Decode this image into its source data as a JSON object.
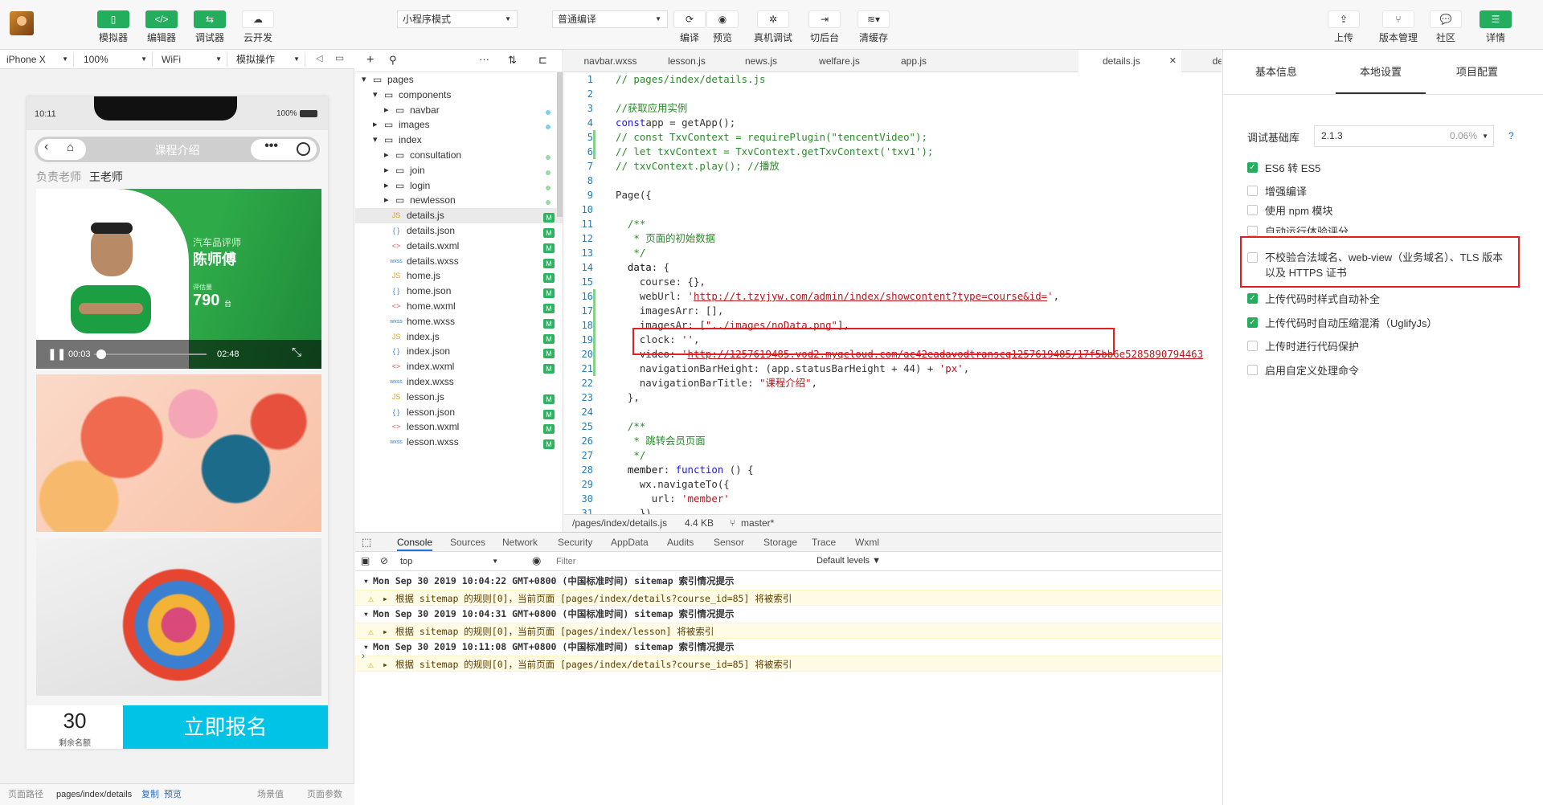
{
  "toolbar": {
    "simulator": "模拟器",
    "editor": "编辑器",
    "debugger": "调试器",
    "cloud": "云开发",
    "mode_select": "小程序模式",
    "compile_select": "普通编译",
    "compile": "编译",
    "preview": "预览",
    "real_debug": "真机调试",
    "switch_bg": "切后台",
    "clear_cache": "清缓存",
    "upload": "上传",
    "version": "版本管理",
    "community": "社区",
    "details": "详情"
  },
  "device_bar": {
    "device": "iPhone X",
    "zoom": "100%",
    "network": "WiFi",
    "simulate": "模拟操作"
  },
  "phone": {
    "time": "10:11",
    "battery": "100%",
    "nav_title": "课程介绍",
    "teacher_label": "负责老师",
    "teacher_name": "王老师",
    "video_role": "汽车品评师",
    "video_name": "陈师傅",
    "video_score_label": "评估量",
    "video_score": "790",
    "video_score_unit": "台",
    "video_current": "00:03",
    "video_total": "02:48",
    "video_progress": 0.02,
    "remaining_count": "30",
    "remaining_label": "剩余名额",
    "signup_button": "立即报名"
  },
  "page_path": {
    "label": "页面路径",
    "path": "pages/index/details",
    "copy": "复制",
    "preview": "预览",
    "scene": "场景值",
    "params": "页面参数"
  },
  "file_tree": [
    {
      "name": "pages",
      "type": "folder",
      "depth": 0,
      "open": true
    },
    {
      "name": "components",
      "type": "folder",
      "depth": 1,
      "open": true
    },
    {
      "name": "navbar",
      "type": "folder",
      "depth": 2,
      "open": false,
      "dot": "blue"
    },
    {
      "name": "images",
      "type": "folder",
      "depth": 1,
      "open": false,
      "dot": "blue"
    },
    {
      "name": "index",
      "type": "folder",
      "depth": 1,
      "open": true
    },
    {
      "name": "consultation",
      "type": "folder",
      "depth": 2,
      "open": false,
      "dot": "green"
    },
    {
      "name": "join",
      "type": "folder",
      "depth": 2,
      "open": false,
      "dot": "green"
    },
    {
      "name": "login",
      "type": "folder",
      "depth": 2,
      "open": false,
      "dot": "green"
    },
    {
      "name": "newlesson",
      "type": "folder",
      "depth": 2,
      "open": false,
      "dot": "green"
    },
    {
      "name": "details.js",
      "type": "JS",
      "depth": 2,
      "badge": "M",
      "selected": true
    },
    {
      "name": "details.json",
      "type": "{ }",
      "depth": 2,
      "badge": "M"
    },
    {
      "name": "details.wxml",
      "type": "<>",
      "depth": 2,
      "badge": "M"
    },
    {
      "name": "details.wxss",
      "type": "wxss",
      "depth": 2,
      "badge": "M"
    },
    {
      "name": "home.js",
      "type": "JS",
      "depth": 2,
      "badge": "M"
    },
    {
      "name": "home.json",
      "type": "{ }",
      "depth": 2,
      "badge": "M"
    },
    {
      "name": "home.wxml",
      "type": "<>",
      "depth": 2,
      "badge": "M"
    },
    {
      "name": "home.wxss",
      "type": "wxss",
      "depth": 2,
      "badge": "M"
    },
    {
      "name": "index.js",
      "type": "JS",
      "depth": 2,
      "badge": "M"
    },
    {
      "name": "index.json",
      "type": "{ }",
      "depth": 2,
      "badge": "M"
    },
    {
      "name": "index.wxml",
      "type": "<>",
      "depth": 2,
      "badge": "M"
    },
    {
      "name": "index.wxss",
      "type": "wxss",
      "depth": 2,
      "badge": ""
    },
    {
      "name": "lesson.js",
      "type": "JS",
      "depth": 2,
      "badge": "M"
    },
    {
      "name": "lesson.json",
      "type": "{ }",
      "depth": 2,
      "badge": "M"
    },
    {
      "name": "lesson.wxml",
      "type": "<>",
      "depth": 2,
      "badge": "M"
    },
    {
      "name": "lesson.wxss",
      "type": "wxss",
      "depth": 2,
      "badge": "M"
    }
  ],
  "editor": {
    "tabs": [
      "navbar.wxss",
      "lesson.js",
      "news.js",
      "welfare.js",
      "app.js",
      "details.js",
      "det"
    ],
    "active_tab": "details.js",
    "status_path": "/pages/index/details.js",
    "status_size": "4.4 KB",
    "status_branch": "master*",
    "lines": [
      [
        [
          "c-com",
          "// pages/index/details.js"
        ]
      ],
      [],
      [
        [
          "c-com",
          "//获取应用实例"
        ]
      ],
      [
        [
          "c-kw",
          "const"
        ],
        [
          "",
          "app = getApp();"
        ]
      ],
      [
        [
          "c-com",
          "// const TxvContext = requirePlugin(\"tencentVideo\");"
        ]
      ],
      [
        [
          "c-com",
          "// let txvContext = TxvContext.getTxvContext('txv1');"
        ]
      ],
      [
        [
          "c-com",
          "// txvContext.play(); //播放"
        ]
      ],
      [],
      [
        [
          "",
          "Page({"
        ]
      ],
      [],
      [
        [
          "c-com",
          "  /**"
        ]
      ],
      [
        [
          "c-com",
          "   * 页面的初始数据"
        ]
      ],
      [
        [
          "c-com",
          "   */"
        ]
      ],
      [
        [
          "c-key",
          "  data"
        ],
        [
          "",
          ": {"
        ]
      ],
      [
        [
          "",
          "    course: {},"
        ]
      ],
      [
        [
          "",
          "    webUrl: "
        ],
        [
          "c-str",
          "'"
        ],
        [
          "c-url",
          "http://t.tzyjyw.com/admin/index/showcontent?type=course&id="
        ],
        [
          "c-str",
          "'"
        ],
        [
          "",
          ","
        ]
      ],
      [
        [
          "",
          "    imagesArr: [],"
        ]
      ],
      [
        [
          "",
          "    imagesAr: ["
        ],
        [
          "c-str",
          "\"../images/noData.png\""
        ],
        [
          "",
          "],"
        ]
      ],
      [
        [
          "",
          "    clock: "
        ],
        [
          "c-str",
          "''"
        ],
        [
          "",
          ","
        ]
      ],
      [
        [
          "",
          "    video: "
        ],
        [
          "c-str",
          "'"
        ],
        [
          "c-url",
          "http://1257619485.vod2.myqcloud.com/ac42eadavodtranscq1257619485/17f5bb6e5285890794463"
        ]
      ],
      [
        [
          "",
          "    navigationBarHeight: (app.statusBarHeight + 44) + "
        ],
        [
          "c-str",
          "'px'"
        ],
        [
          "",
          ","
        ]
      ],
      [
        [
          "",
          "    navigationBarTitle: "
        ],
        [
          "c-str",
          "\"课程介绍\""
        ],
        [
          "",
          ","
        ]
      ],
      [
        [
          "",
          "  },"
        ]
      ],
      [],
      [
        [
          "c-com",
          "  /**"
        ]
      ],
      [
        [
          "c-com",
          "   * 跳转会员页面"
        ]
      ],
      [
        [
          "c-com",
          "   */"
        ]
      ],
      [
        [
          "c-key",
          "  member"
        ],
        [
          "",
          ": "
        ],
        [
          "c-kw",
          "function"
        ],
        [
          "",
          " () {"
        ]
      ],
      [
        [
          "",
          "    wx.navigateTo({"
        ]
      ],
      [
        [
          "",
          "      url: "
        ],
        [
          "c-str",
          "'member'"
        ]
      ],
      [
        [
          "",
          "    })"
        ]
      ]
    ],
    "modified_lines": [
      5,
      6,
      16,
      17,
      18,
      19,
      20,
      21
    ]
  },
  "console": {
    "tabs": [
      "Console",
      "Sources",
      "Network",
      "Security",
      "AppData",
      "Audits",
      "Sensor",
      "Storage",
      "Trace",
      "Wxml"
    ],
    "context": "top",
    "filter_placeholder": "Filter",
    "levels": "Default levels",
    "logs": [
      {
        "kind": "group",
        "text": "Mon Sep 30 2019 10:04:22 GMT+0800 (中国标准时间) sitemap 索引情况提示"
      },
      {
        "kind": "warn",
        "text": "根据 sitemap 的规则[0]，当前页面 [pages/index/details?course_id=85] 将被索引"
      },
      {
        "kind": "group",
        "text": "Mon Sep 30 2019 10:04:31 GMT+0800 (中国标准时间) sitemap 索引情况提示"
      },
      {
        "kind": "warn",
        "text": "根据 sitemap 的规则[0]，当前页面 [pages/index/lesson] 将被索引"
      },
      {
        "kind": "group",
        "text": "Mon Sep 30 2019 10:11:08 GMT+0800 (中国标准时间) sitemap 索引情况提示"
      },
      {
        "kind": "warn",
        "text": "根据 sitemap 的规则[0]，当前页面 [pages/index/details?course_id=85] 将被索引"
      }
    ]
  },
  "settings": {
    "tabs": [
      "基本信息",
      "本地设置",
      "项目配置"
    ],
    "active_tab": "本地设置",
    "base_lib_label": "调试基础库",
    "base_lib_version": "2.1.3",
    "base_lib_usage": "0.06%",
    "help": "?",
    "options": [
      {
        "label": "ES6 转 ES5",
        "checked": true
      },
      {
        "label": "增强编译",
        "checked": false
      },
      {
        "label": "使用 npm 模块",
        "checked": false
      },
      {
        "label": "自动运行体验评分",
        "checked": false
      },
      {
        "label": "不校验合法域名、web-view（业务域名）、TLS 版本以及 HTTPS 证书",
        "checked": false
      },
      {
        "label": "上传代码时样式自动补全",
        "checked": true
      },
      {
        "label": "上传代码时自动压缩混淆（UglifyJs）",
        "checked": true
      },
      {
        "label": "上传时进行代码保护",
        "checked": false
      },
      {
        "label": "启用自定义处理命令",
        "checked": false
      }
    ]
  },
  "colors": {
    "accent_green": "#23ad5c",
    "highlight_red": "#e02020",
    "signup_blue": "#00c3e6"
  }
}
